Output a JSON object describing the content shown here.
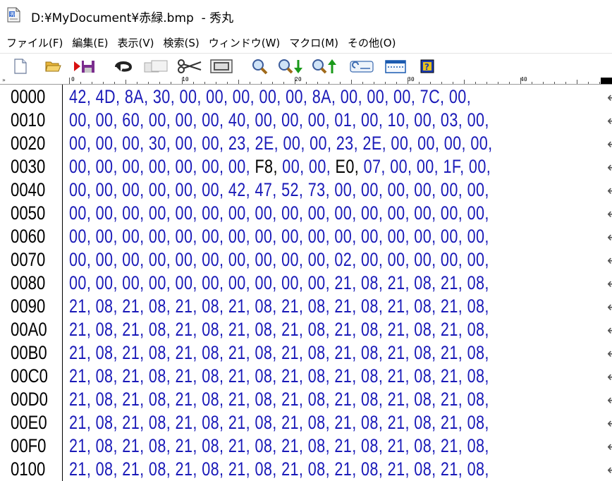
{
  "window": {
    "title": "D:¥MyDocument¥赤緑.bmp  - 秀丸"
  },
  "menu": [
    "ファイル(F)",
    "編集(E)",
    "表示(V)",
    "検索(S)",
    "ウィンドウ(W)",
    "マクロ(M)",
    "その他(O)"
  ],
  "toolbar": {
    "icons": [
      "new-file-icon",
      "open-folder-icon",
      "save-icon",
      "undo-icon",
      "copy-icon",
      "cut-icon",
      "paste-icon",
      "search-icon",
      "search-down-icon",
      "search-up-icon",
      "rewrite-icon",
      "window-icon",
      "help-icon"
    ]
  },
  "ruler": {
    "corner": "»",
    "labels": [
      "0",
      "10",
      "20",
      "30",
      "40"
    ]
  },
  "editor": {
    "continuation": "←",
    "rows": [
      {
        "addr": "0000",
        "hex": "42, 4D, 8A, 30, 00, 00, 00, 00, 00, 8A, 00, 00, 00, 7C, 00,"
      },
      {
        "addr": "0010",
        "hex": "00, 00, 60, 00, 00, 00, 40, 00, 00, 00, 01, 00, 10, 00, 03, 00,"
      },
      {
        "addr": "0020",
        "hex": "00, 00, 00, 30, 00, 00, 23, 2E, 00, 00, 23, 2E, 00, 00, 00, 00,"
      },
      {
        "addr": "0030",
        "hex": "00, 00, 00, 00, 00, 00, 00, F8, 00, 00, E0, 07, 00, 00, 1F, 00,"
      },
      {
        "addr": "0040",
        "hex": "00, 00, 00, 00, 00, 00, 42, 47, 52, 73, 00, 00, 00, 00, 00, 00,"
      },
      {
        "addr": "0050",
        "hex": "00, 00, 00, 00, 00, 00, 00, 00, 00, 00, 00, 00, 00, 00, 00, 00,"
      },
      {
        "addr": "0060",
        "hex": "00, 00, 00, 00, 00, 00, 00, 00, 00, 00, 00, 00, 00, 00, 00, 00,"
      },
      {
        "addr": "0070",
        "hex": "00, 00, 00, 00, 00, 00, 00, 00, 00, 00, 02, 00, 00, 00, 00, 00,"
      },
      {
        "addr": "0080",
        "hex": "00, 00, 00, 00, 00, 00, 00, 00, 00, 00, 21, 08, 21, 08, 21, 08,"
      },
      {
        "addr": "0090",
        "hex": "21, 08, 21, 08, 21, 08, 21, 08, 21, 08, 21, 08, 21, 08, 21, 08,"
      },
      {
        "addr": "00A0",
        "hex": "21, 08, 21, 08, 21, 08, 21, 08, 21, 08, 21, 08, 21, 08, 21, 08,"
      },
      {
        "addr": "00B0",
        "hex": "21, 08, 21, 08, 21, 08, 21, 08, 21, 08, 21, 08, 21, 08, 21, 08,"
      },
      {
        "addr": "00C0",
        "hex": "21, 08, 21, 08, 21, 08, 21, 08, 21, 08, 21, 08, 21, 08, 21, 08,"
      },
      {
        "addr": "00D0",
        "hex": "21, 08, 21, 08, 21, 08, 21, 08, 21, 08, 21, 08, 21, 08, 21, 08,"
      },
      {
        "addr": "00E0",
        "hex": "21, 08, 21, 08, 21, 08, 21, 08, 21, 08, 21, 08, 21, 08, 21, 08,"
      },
      {
        "addr": "00F0",
        "hex": "21, 08, 21, 08, 21, 08, 21, 08, 21, 08, 21, 08, 21, 08, 21, 08,"
      },
      {
        "addr": "0100",
        "hex": "21, 08, 21, 08, 21, 08, 21, 08, 21, 08, 21, 08, 21, 08, 21, 08,"
      }
    ]
  }
}
